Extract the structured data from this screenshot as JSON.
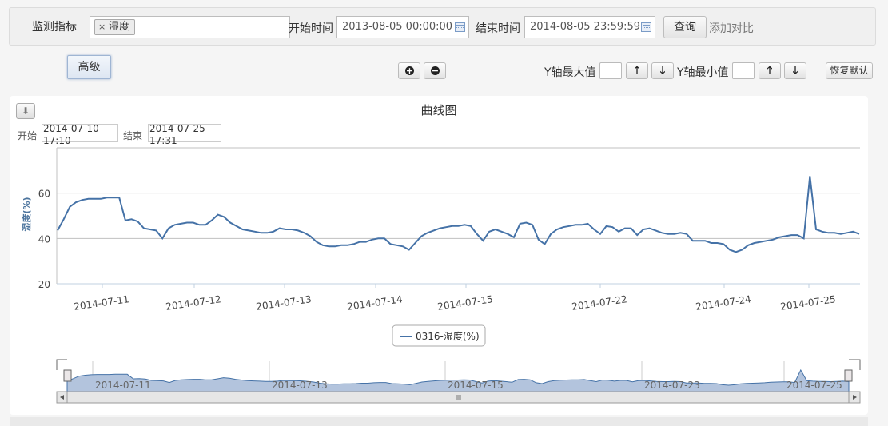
{
  "query": {
    "metric_label": "监测指标",
    "metric_tag": "湿度",
    "start_label": "开始时间",
    "start_value": "2013-08-05 00:00:00",
    "end_label": "结束时间",
    "end_value": "2014-08-05 23:59:59",
    "search_label": "查询",
    "compare_label": "添加对比"
  },
  "toolbar": {
    "advanced_label": "高级",
    "zoom_in": "+",
    "zoom_out": "−",
    "ymax_label": "Y轴最大值",
    "ymin_label": "Y轴最小值",
    "up_glyph": "🡑",
    "down_glyph": "🡓",
    "reset_label": "恢复默认"
  },
  "range": {
    "start_label": "开始",
    "start_value": "2014-07-10 17:10",
    "end_label": "结束",
    "end_value": "2014-07-25 17:31"
  },
  "chart_data": {
    "type": "line",
    "title": "曲线图",
    "ylabel": "湿度(%)",
    "xlabel": "",
    "ylim": [
      20,
      80
    ],
    "yticks": [
      20,
      40,
      60
    ],
    "grid": true,
    "legend_position": "bottom-center",
    "color": "#4572a7",
    "x_tick_labels": [
      "2014-07-11",
      "2014-07-12",
      "2014-07-13",
      "2014-07-14",
      "2014-07-15",
      "2014-07-22",
      "2014-07-24",
      "2014-07-25"
    ],
    "navigator_labels": [
      "2014-07-11",
      "2014-07-13",
      "2014-07-15",
      "2014-07-23",
      "2014-07-25"
    ],
    "series": [
      {
        "name": "0316-湿度(%)",
        "values": [
          43.5,
          48.5,
          54.0,
          56.0,
          57.0,
          57.5,
          57.5,
          57.5,
          58.0,
          58.0,
          58.0,
          48.0,
          48.5,
          47.5,
          44.5,
          44.0,
          43.5,
          40.0,
          44.5,
          46.0,
          46.5,
          47.0,
          47.0,
          46.0,
          46.0,
          48.0,
          50.5,
          49.5,
          47.0,
          45.5,
          44.0,
          43.5,
          43.0,
          42.5,
          42.5,
          43.0,
          44.5,
          44.0,
          44.0,
          43.5,
          42.5,
          41.0,
          38.5,
          37.0,
          36.5,
          36.5,
          37.0,
          37.0,
          37.5,
          38.5,
          38.5,
          39.5,
          40.0,
          40.0,
          37.5,
          37.0,
          36.5,
          35.0,
          38.0,
          41.0,
          42.5,
          43.5,
          44.5,
          45.0,
          45.5,
          45.5,
          46.0,
          45.5,
          42.0,
          39.0,
          43.0,
          44.0,
          43.0,
          42.0,
          40.5,
          46.5,
          47.0,
          46.0,
          39.5,
          37.5,
          42.0,
          44.0,
          45.0,
          45.5,
          46.0,
          46.0,
          46.5,
          44.0,
          42.0,
          45.5,
          45.0,
          43.0,
          44.5,
          44.5,
          41.5,
          44.0,
          44.5,
          43.5,
          42.5,
          42.0,
          42.0,
          42.5,
          42.0,
          39.0,
          39.0,
          39.0,
          38.0,
          38.0,
          37.5,
          35.0,
          34.0,
          35.0,
          37.0,
          38.0,
          38.5,
          39.0,
          39.5,
          40.5,
          41.0,
          41.5,
          41.5,
          40.0,
          67.5,
          44.0,
          43.0,
          42.5,
          42.5,
          42.0,
          42.5,
          43.0,
          42.0
        ]
      }
    ]
  }
}
